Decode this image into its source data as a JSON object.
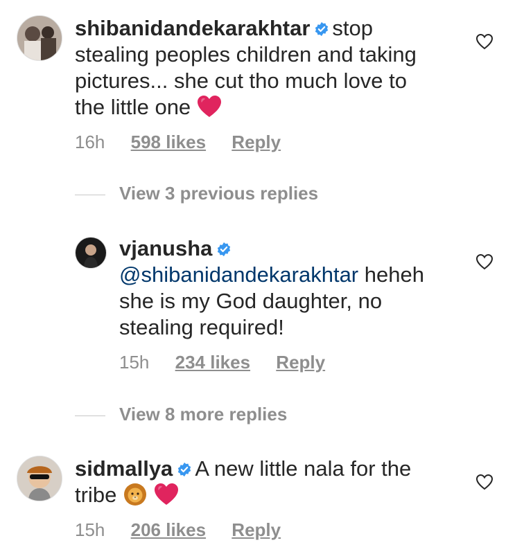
{
  "comments": [
    {
      "username": "shibanidandekarakhtar",
      "text": "stop stealing peoples children and taking pictures... she cut tho much love to the little one",
      "line1": "stop",
      "line2": "stealing peoples children and taking",
      "line3": "pictures... she cut tho much love to",
      "line4": "the little one",
      "time": "16h",
      "likes": "598 likes",
      "reply": "Reply"
    },
    {
      "username": "vjanusha",
      "mention": "@shibanidandekarakhtar",
      "line1_rest": "heheh",
      "line2": "she is my God daughter, no",
      "line3": "stealing required!",
      "time": "15h",
      "likes": "234 likes",
      "reply": "Reply"
    },
    {
      "username": "sidmallya",
      "line1": "A new little nala for the",
      "line2": "tribe",
      "time": "15h",
      "likes": "206 likes",
      "reply": "Reply"
    }
  ],
  "view_previous": "View 3 previous replies",
  "view_more": "View 8 more replies",
  "colors": {
    "verified": "#3897f0",
    "heart_emoji": "#e0245e",
    "meta": "#8e8e8e",
    "mention": "#00376b"
  },
  "icons": {
    "verified": "verified-badge-icon",
    "like": "heart-outline-icon",
    "heart_emoji": "red-heart-emoji",
    "lion_emoji": "lion-face-emoji"
  }
}
